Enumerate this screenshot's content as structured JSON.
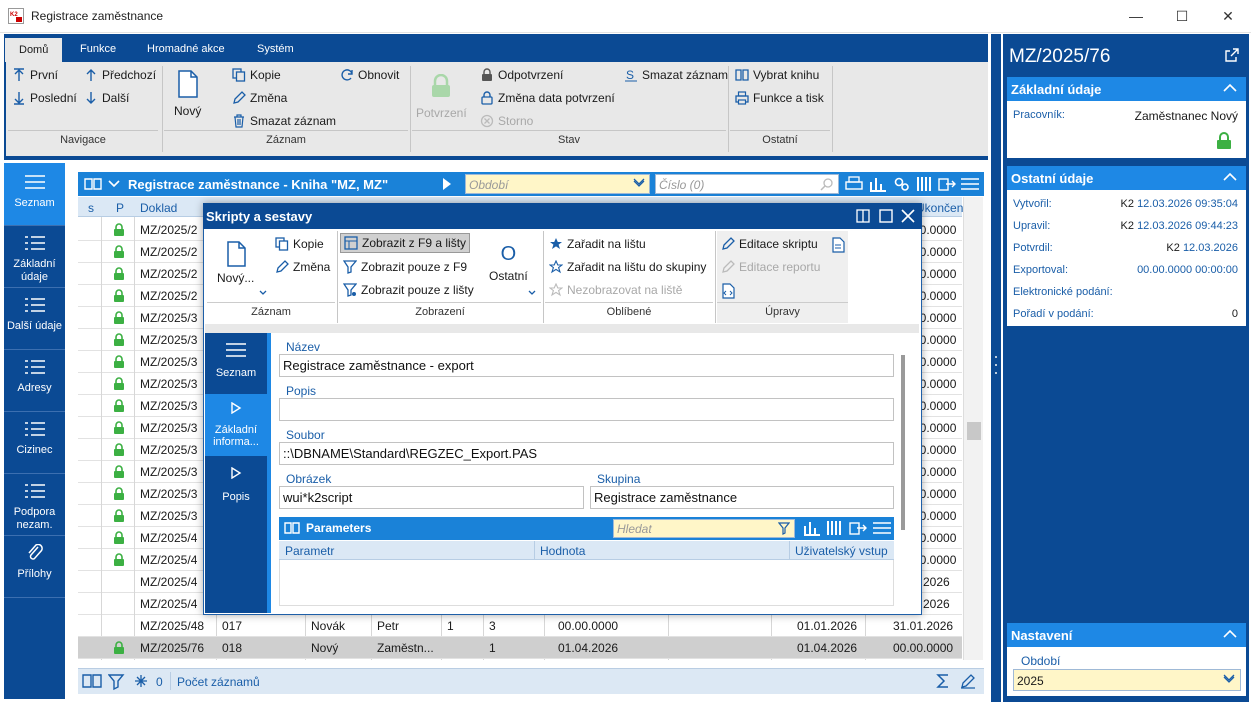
{
  "window": {
    "title": "Registrace zaměstnance",
    "app_icon": "k2-app-icon",
    "minimize": "—",
    "maximize": "☐",
    "close": "✕"
  },
  "ribbon": {
    "tabs": [
      "Domů",
      "Funkce",
      "Hromadné akce",
      "Systém"
    ],
    "nav": {
      "first": "První",
      "prev": "Předchozí",
      "last": "Poslední",
      "next": "Další",
      "group": "Navigace"
    },
    "record": {
      "new": "Nový",
      "copy": "Kopie",
      "refresh": "Obnovit",
      "change": "Změna",
      "delete": "Smazat záznam",
      "group": "Záznam"
    },
    "state": {
      "confirm": "Potvrzení",
      "unconfirm": "Odpotvrzení",
      "change_date": "Změna data potvrzení",
      "storno": "Storno",
      "delete": "Smazat záznam",
      "group": "Stav"
    },
    "other": {
      "choose_book": "Vybrat knihu",
      "functions_print": "Funkce a tisk",
      "group": "Ostatní"
    }
  },
  "leftnav": [
    "Seznam",
    "Základní údaje",
    "Další údaje",
    "Adresy",
    "Cizinec",
    "Podpora nezam.",
    "Přílohy"
  ],
  "grid": {
    "title": "Registrace zaměstnance - Kniha \"MZ, MZ\"",
    "period_placeholder": "Období",
    "number_placeholder": "Číslo (0)",
    "columns": [
      "s",
      "P",
      "Doklad",
      "Ukončení"
    ],
    "rows": [
      {
        "doc": "MZ/2025/2",
        "lock": true,
        "end": "00.0000"
      },
      {
        "doc": "MZ/2025/2",
        "lock": true,
        "end": "00.0000"
      },
      {
        "doc": "MZ/2025/2",
        "lock": true,
        "end": "00.0000"
      },
      {
        "doc": "MZ/2025/2",
        "lock": true,
        "end": "00.0000"
      },
      {
        "doc": "MZ/2025/3",
        "lock": true,
        "end": "00.0000"
      },
      {
        "doc": "MZ/2025/3",
        "lock": true,
        "end": "00.0000"
      },
      {
        "doc": "MZ/2025/3",
        "lock": true,
        "end": "00.0000"
      },
      {
        "doc": "MZ/2025/3",
        "lock": true,
        "end": "00.0000"
      },
      {
        "doc": "MZ/2025/3",
        "lock": true,
        "end": "00.0000"
      },
      {
        "doc": "MZ/2025/3",
        "lock": true,
        "end": "00.0000"
      },
      {
        "doc": "MZ/2025/3",
        "lock": true,
        "end": "00.0000"
      },
      {
        "doc": "MZ/2025/3",
        "lock": true,
        "end": "00.0000"
      },
      {
        "doc": "MZ/2025/3",
        "lock": true,
        "end": "00.0000"
      },
      {
        "doc": "MZ/2025/3",
        "lock": true,
        "end": "00.0000"
      },
      {
        "doc": "MZ/2025/4",
        "lock": true,
        "end": "00.0000"
      },
      {
        "doc": "MZ/2025/4",
        "lock": true,
        "end": "00.0000"
      },
      {
        "doc": "MZ/2025/4",
        "lock": false,
        "end": "2.2026"
      },
      {
        "doc": "MZ/2025/4",
        "lock": false,
        "end": "3.2026"
      }
    ],
    "row48": {
      "doc": "MZ/2025/48",
      "num": "017",
      "surname": "Novák",
      "name": "Petr",
      "c1": "1",
      "c2": "3",
      "date1": "00.00.0000",
      "start": "01.01.2026",
      "end": "31.01.2026"
    },
    "row76": {
      "doc": "MZ/2025/76",
      "num": "018",
      "surname": "Nový",
      "name": "Zaměstn...",
      "c2": "1",
      "date1": "01.04.2026",
      "start": "01.04.2026",
      "end": "00.00.0000"
    },
    "status": {
      "filter_count": "0",
      "records": "Počet záznamů"
    }
  },
  "right": {
    "title": "MZ/2025/76",
    "basic": {
      "header": "Základní údaje",
      "worker_label": "Pracovník:",
      "worker_value": "Zaměstnanec Nový"
    },
    "other": {
      "header": "Ostatní údaje",
      "created_label": "Vytvořil:",
      "created_user": "K2",
      "created_date": "12.03.2026 09:35:04",
      "updated_label": "Upravil:",
      "updated_user": "K2",
      "updated_date": "12.03.2026 09:44:23",
      "confirmed_label": "Potvrdil:",
      "confirmed_user": "K2",
      "confirmed_date": "12.03.2026",
      "exported_label": "Exportoval:",
      "exported_date": "00.00.0000 00:00:00",
      "efiling_label": "Elektronické podání:",
      "order_label": "Pořadí v podání:",
      "order_value": "0"
    },
    "settings": {
      "header": "Nastavení",
      "period_label": "Období",
      "period_value": "2025"
    }
  },
  "dialog": {
    "title": "Skripty a sestavy",
    "ribbon": {
      "new": "Nový...",
      "copy": "Kopie",
      "change": "Změna",
      "g1": "Záznam",
      "show_f9_bar": "Zobrazit z F9 a lišty",
      "show_f9": "Zobrazit pouze z F9",
      "show_bar": "Zobrazit pouze z lišty",
      "other": "Ostatní",
      "g2": "Zobrazení",
      "add_bar": "Zařadit na lištu",
      "add_bar_group": "Zařadit na lištu do skupiny",
      "hide_bar": "Nezobrazovat na liště",
      "g3": "Oblíbené",
      "edit_script": "Editace skriptu",
      "edit_report": "Editace reportu",
      "g4": "Úpravy"
    },
    "nav": [
      "Seznam",
      "Základní informa...",
      "Popis"
    ],
    "fields": {
      "name_label": "Název",
      "name_value": "Registrace zaměstnance - export",
      "desc_label": "Popis",
      "desc_value": "",
      "file_label": "Soubor",
      "file_value": "::\\DBNAME\\Standard\\REGZEC_Export.PAS",
      "image_label": "Obrázek",
      "image_value": "wui*k2script",
      "group_label": "Skupina",
      "group_value": "Registrace zaměstnance"
    },
    "params": {
      "title": "Parameters",
      "search_placeholder": "Hledat",
      "cols": [
        "Parametr",
        "Hodnota",
        "Uživatelský vstup"
      ]
    }
  },
  "colors": {
    "ribbon": "#0b4a94",
    "accent": "#1e88e5",
    "gridhead": "#1a82d8",
    "lock": "#3cb043",
    "link": "#1a5ea8"
  }
}
